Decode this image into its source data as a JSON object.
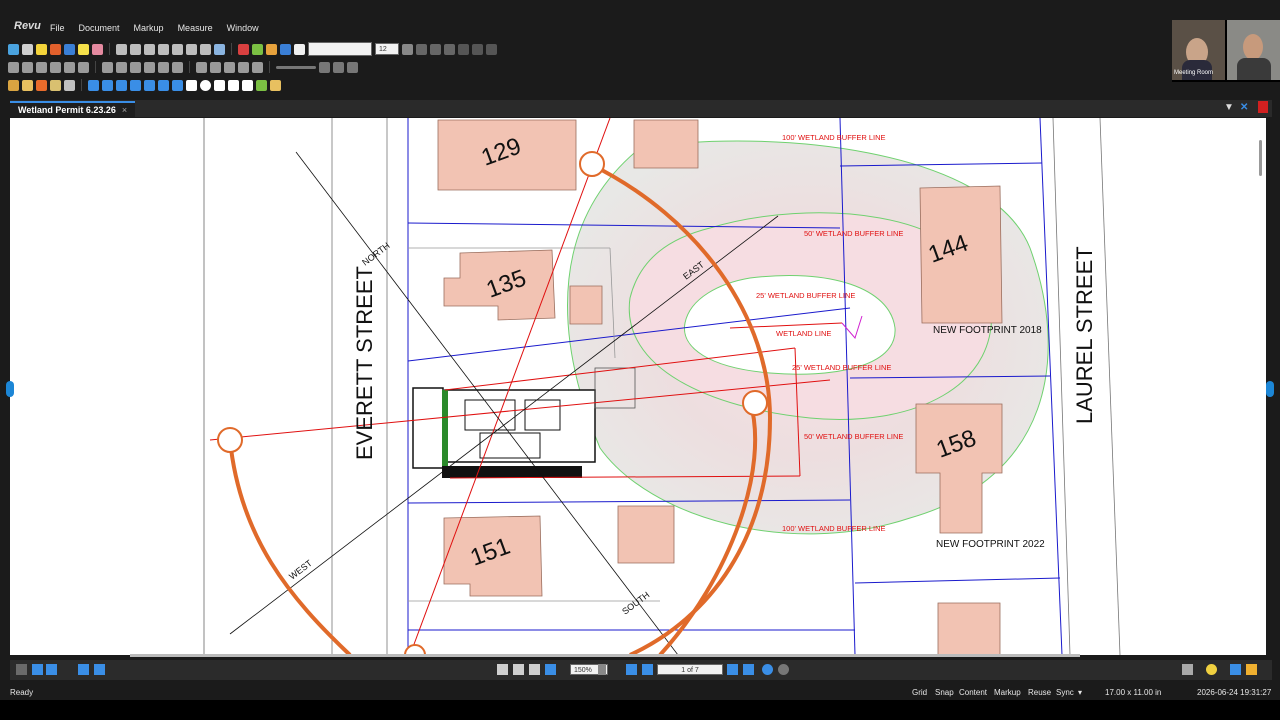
{
  "app": {
    "logo": "Revu"
  },
  "menu": [
    "File",
    "Document",
    "Markup",
    "Measure",
    "Window"
  ],
  "toolbar": {
    "font_size": "12"
  },
  "tab": {
    "title": "Wetland Permit 6.23.26",
    "close": "×"
  },
  "drawing": {
    "streets": {
      "left": "EVERETT STREET",
      "right": "LAUREL STREET"
    },
    "lots": [
      "129",
      "135",
      "144",
      "151",
      "158"
    ],
    "directions": {
      "north": "NORTH",
      "east": "EAST",
      "west": "WEST",
      "south": "SOUTH"
    },
    "buffer_labels": {
      "b100_top": "100' WETLAND BUFFER LINE",
      "b50_top": "50' WETLAND BUFFER LINE",
      "b25_top": "25' WETLAND BUFFER LINE",
      "wetland": "WETLAND LINE",
      "b25_bottom": "25' WETLAND BUFFER LINE",
      "b50_bottom": "50' WETLAND BUFFER LINE",
      "b100_bottom": "100' WETLAND BUFFER LINE"
    },
    "footprints": {
      "f2018": "NEW FOOTPRINT 2018",
      "f2022": "NEW FOOTPRINT 2022"
    }
  },
  "navigation": {
    "zoom": "150%",
    "page": "1 of 7"
  },
  "status": {
    "left": "Ready",
    "items": [
      "Grid",
      "Snap",
      "Content",
      "Markup",
      "Reuse",
      "Sync"
    ],
    "size": "17.00 x 11.00 in",
    "datetime": "2026-06-24 19:31:27"
  },
  "video": {
    "participant": "Meeting Room"
  },
  "colors": {
    "accent": "#1c86d6",
    "sun_path": "#e06a2a",
    "building": "#f2c3b3",
    "buffer_green": "#6fd16f",
    "lot_blue": "#1a1acc",
    "red": "#e01010"
  }
}
